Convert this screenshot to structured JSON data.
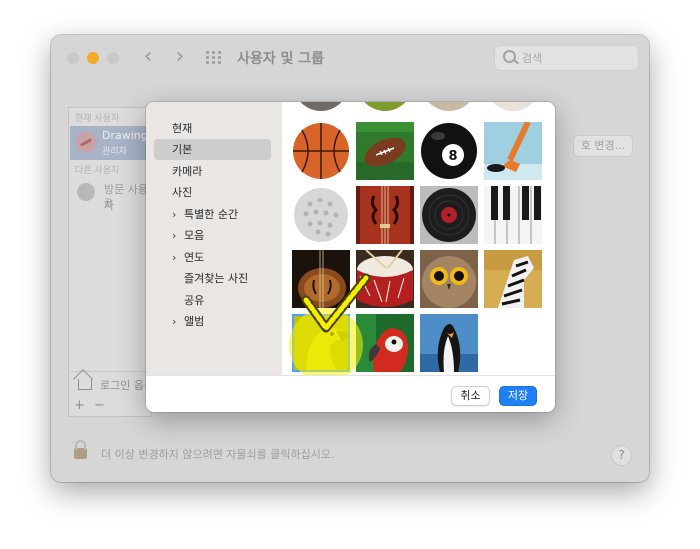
{
  "window": {
    "title": "사용자 및 그룹",
    "search_placeholder": "검색",
    "current_user_section": "현재 사용자",
    "current_user_name": "Drawing",
    "current_user_role": "관리자",
    "other_users_section": "다른 사용자",
    "guest_name": "방문 사용자",
    "guest_sub": "끔",
    "login_options": "로그인 옵션",
    "plus": "+",
    "minus": "−",
    "change_password_btn": "호 변경...",
    "lock_message": "더 이상 변경하지 않으려면 자물쇠를 클릭하십시오.",
    "help": "?"
  },
  "picker": {
    "sidebar": [
      {
        "label": "현재"
      },
      {
        "label": "기본",
        "selected": true
      },
      {
        "label": "카메라"
      },
      {
        "label": "사진"
      },
      {
        "label": "특별한 순간",
        "expandable": true
      },
      {
        "label": "모음",
        "expandable": true
      },
      {
        "label": "연도",
        "expandable": true
      },
      {
        "label": "즐겨찾는 사진"
      },
      {
        "label": "공유"
      },
      {
        "label": "앨범",
        "expandable": true
      }
    ],
    "tiles": [
      "basketball",
      "football",
      "8-ball",
      "hockey",
      "golf",
      "violin",
      "vinyl",
      "piano",
      "guitar",
      "drum",
      "owl",
      "zebra",
      "eagle",
      "parrot",
      "penguin"
    ],
    "selected_tile": "eagle",
    "cancel_label": "취소",
    "save_label": "저장",
    "accent_color": "#1f7ff5",
    "highlight_color": "#f6f000"
  }
}
